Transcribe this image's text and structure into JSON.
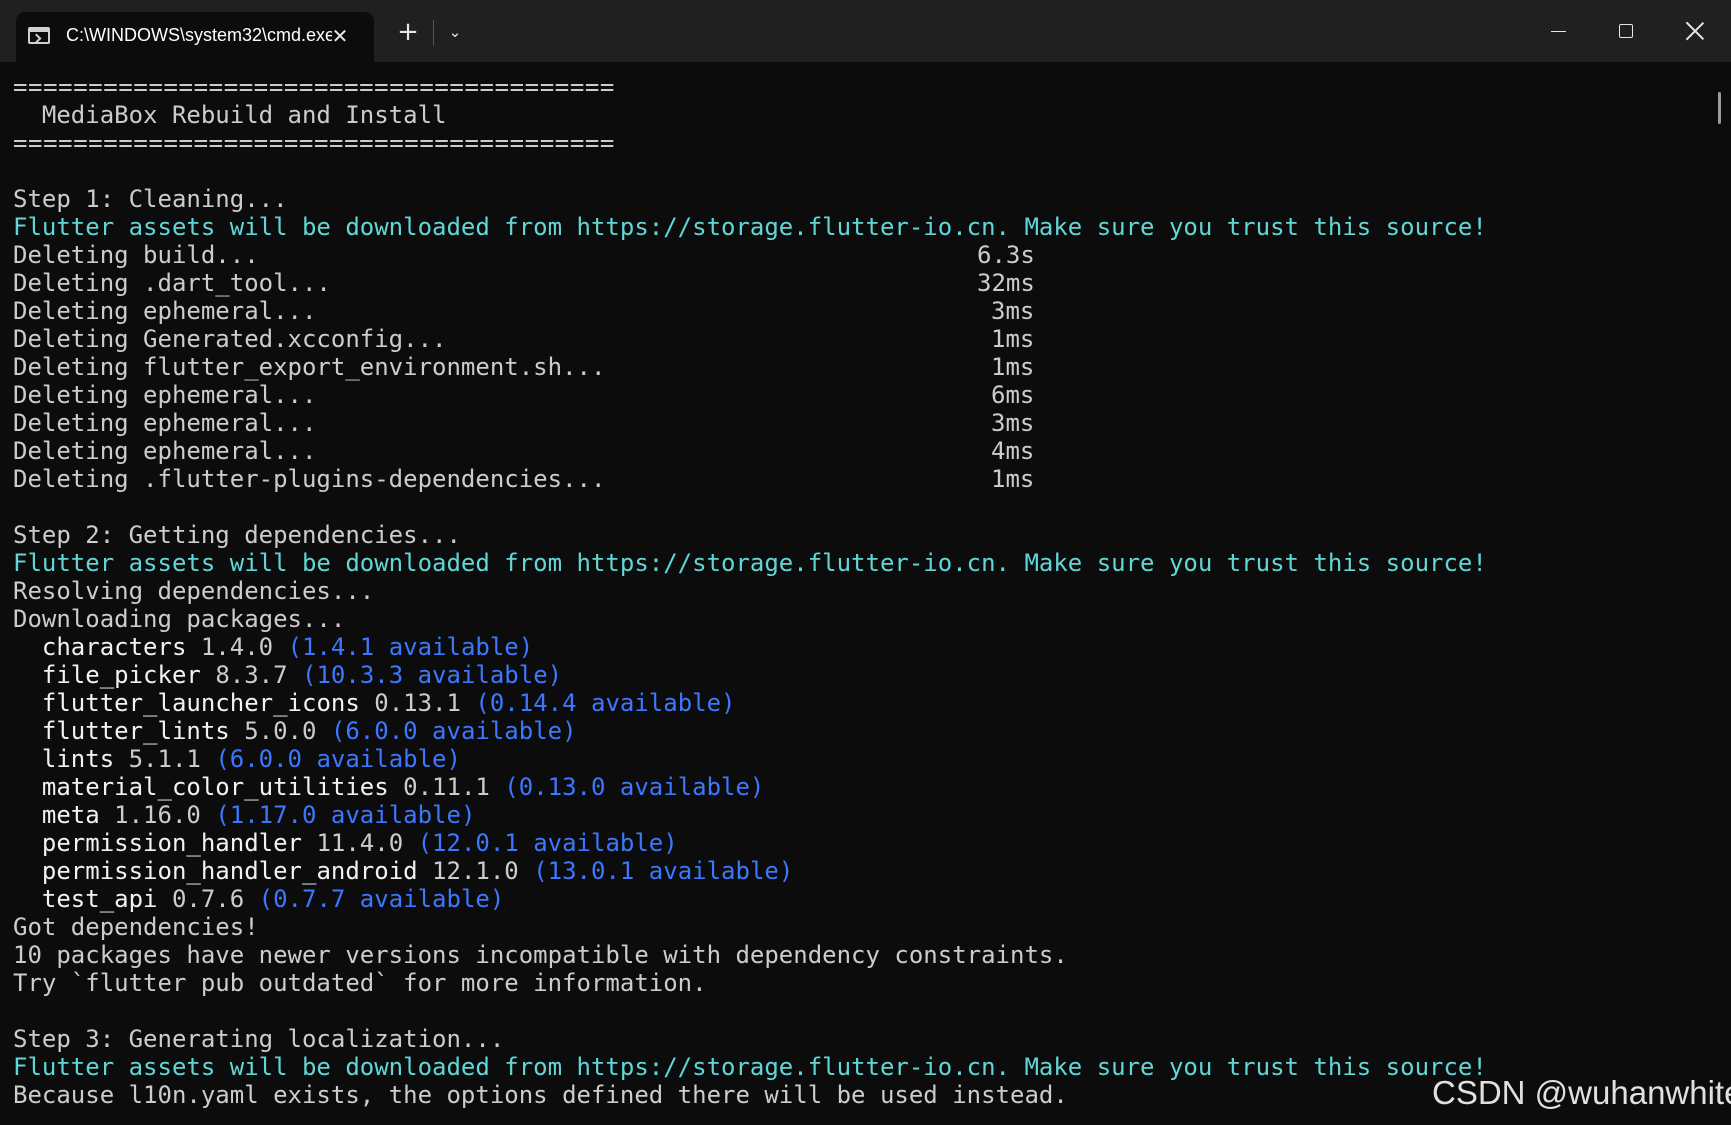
{
  "window": {
    "tab_title": "C:\\WINDOWS\\system32\\cmd.exe",
    "tab_close_glyph": "✕",
    "new_tab_glyph": "+",
    "dropdown_glyph": "⌄"
  },
  "colors": {
    "background": "#0c0c0c",
    "titlebar": "#202020",
    "default_text": "#cccccc",
    "info_text": "#61d6d6",
    "available_text": "#3b78ff"
  },
  "terminal": {
    "separator": "========================================",
    "heading": "  MediaBox Rebuild and Install",
    "flutter_notice": "Flutter assets will be downloaded from https://storage.flutter-io.cn. Make sure you trust this source!",
    "step1": {
      "title": "Step 1: Cleaning...",
      "deletes": [
        {
          "label": "Deleting build...",
          "time": "6.3s"
        },
        {
          "label": "Deleting .dart_tool...",
          "time": "32ms"
        },
        {
          "label": "Deleting ephemeral...",
          "time": "3ms"
        },
        {
          "label": "Deleting Generated.xcconfig...",
          "time": "1ms"
        },
        {
          "label": "Deleting flutter_export_environment.sh...",
          "time": "1ms"
        },
        {
          "label": "Deleting ephemeral...",
          "time": "6ms"
        },
        {
          "label": "Deleting ephemeral...",
          "time": "3ms"
        },
        {
          "label": "Deleting ephemeral...",
          "time": "4ms"
        },
        {
          "label": "Deleting .flutter-plugins-dependencies...",
          "time": "1ms"
        }
      ]
    },
    "step2": {
      "title": "Step 2: Getting dependencies...",
      "resolving": "Resolving dependencies...",
      "downloading": "Downloading packages...",
      "packages": [
        {
          "name": "characters",
          "version": "1.4.0",
          "available": "(1.4.1 available)"
        },
        {
          "name": "file_picker",
          "version": "8.3.7",
          "available": "(10.3.3 available)"
        },
        {
          "name": "flutter_launcher_icons",
          "version": "0.13.1",
          "available": "(0.14.4 available)"
        },
        {
          "name": "flutter_lints",
          "version": "5.0.0",
          "available": "(6.0.0 available)"
        },
        {
          "name": "lints",
          "version": "5.1.1",
          "available": "(6.0.0 available)"
        },
        {
          "name": "material_color_utilities",
          "version": "0.11.1",
          "available": "(0.13.0 available)"
        },
        {
          "name": "meta",
          "version": "1.16.0",
          "available": "(1.17.0 available)"
        },
        {
          "name": "permission_handler",
          "version": "11.4.0",
          "available": "(12.0.1 available)"
        },
        {
          "name": "permission_handler_android",
          "version": "12.1.0",
          "available": "(13.0.1 available)"
        },
        {
          "name": "test_api",
          "version": "0.7.6",
          "available": "(0.7.7 available)"
        }
      ],
      "got": "Got dependencies!",
      "newer": "10 packages have newer versions incompatible with dependency constraints.",
      "try": "Try `flutter pub outdated` for more information."
    },
    "step3": {
      "title": "Step 3: Generating localization...",
      "l10n": "Because l10n.yaml exists, the options defined there will be used instead."
    }
  },
  "watermark": "CSDN @wuhanwhite"
}
